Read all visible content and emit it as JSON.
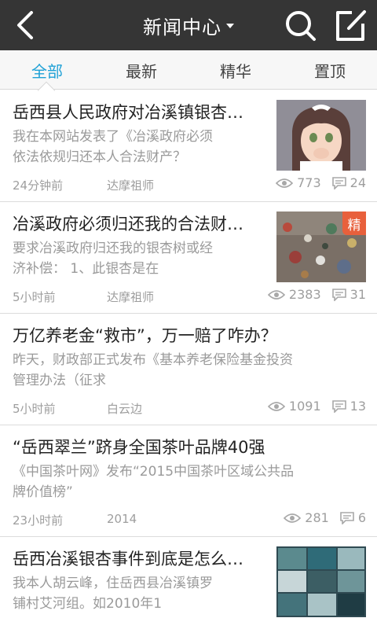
{
  "header": {
    "title": "新闻中心",
    "icons": {
      "back": "back-chevron-icon",
      "search": "search-icon",
      "edit": "compose-icon"
    }
  },
  "tabs": [
    {
      "label": "全部",
      "active": true
    },
    {
      "label": "最新",
      "active": false
    },
    {
      "label": "精华",
      "active": false
    },
    {
      "label": "置顶",
      "active": false
    }
  ],
  "colors": {
    "topbar": "#353535",
    "accent": "#1fa1d6",
    "badge": "#e8603c"
  },
  "articles": [
    {
      "title": "岳西县人民政府对冶溪镇银杏…",
      "summary_line1": "我在本网站发表了《冶溪政府必须",
      "summary_line2": "依法依规归还本人合法财产？",
      "time": "24分钟前",
      "author": "达摩祖师",
      "views": "773",
      "comments": "24",
      "thumbnail": "anime-girl-thumbnail"
    },
    {
      "title": "冶溪政府必须归还我的合法财…",
      "summary_line1": "要求冶溪政府归还我的银杏树或经",
      "summary_line2": "济补偿： 1、此银杏是在",
      "time": "5小时前",
      "author": "达摩祖师",
      "views": "2383",
      "comments": "31",
      "badge": "精",
      "thumbnail": "garbage-pile-thumbnail"
    },
    {
      "title": "万亿养老金“救市”，万一赔了咋办？",
      "summary_line1": "昨天，财政部正式发布《基本养老保险基金投资",
      "summary_line2": "管理办法（征求",
      "time": "5小时前",
      "author": "白云边",
      "views": "1091",
      "comments": "13"
    },
    {
      "title": "“岳西翠兰”跻身全国茶叶品牌40强",
      "summary_line1": "《中国茶叶网》发布“2015中国茶叶区域公共品",
      "summary_line2": "牌价值榜”",
      "time": "23小时前",
      "author": "2014",
      "views": "281",
      "comments": "6"
    },
    {
      "title": "岳西冶溪银杏事件到底是怎么…",
      "summary_line1": "我本人胡云峰，住岳西县冶溪镇罗",
      "summary_line2": "铺村艾河组。如2010年1",
      "thumbnail": "video-collage-thumbnail"
    }
  ]
}
